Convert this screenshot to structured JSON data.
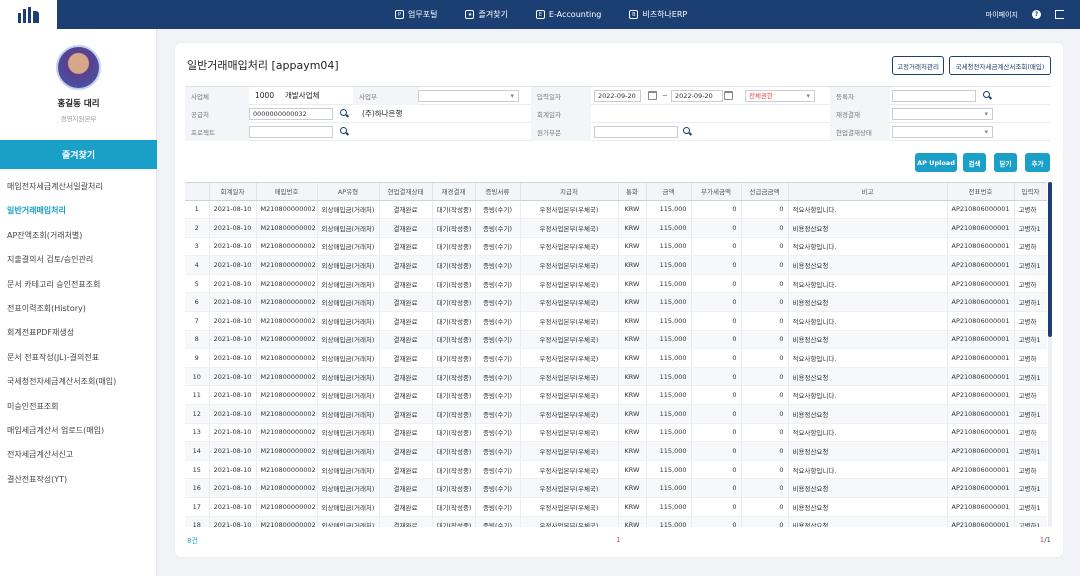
{
  "topbar": {
    "nav": [
      {
        "icon_char": "P",
        "label": "업무포털"
      },
      {
        "icon_char": "★",
        "label": "즐겨찾기"
      },
      {
        "icon_char": "E",
        "label": "E-Accounting"
      },
      {
        "icon_char": "B",
        "label": "비즈하나ERP"
      }
    ],
    "mypage": "마이페이지",
    "help_char": "?"
  },
  "user": {
    "name": "홍길동 대리",
    "dept": "경영지원본부"
  },
  "sidebar": {
    "header": "즐겨찾기",
    "items": [
      "매입전자세금계산서일괄처리",
      "일반거래매입처리",
      "AP잔액조회(거래처별)",
      "지출결의서 검토/승인관리",
      "문서 카테고리 승인전표조회",
      "전표이력조회(History)",
      "회계전표PDF재생성",
      "문서 전표작성(JL)-결의전표",
      "국세청전자세금계산서조회(매입)",
      "미승인전표조회",
      "매입세금계산서 업로드(매입)",
      "전자세금계산서신고",
      "결산전표작성(YT)"
    ]
  },
  "page": {
    "title": "일반거래매입처리  [appaym04]",
    "btn_supplier": "고정거래처관리",
    "btn_nts": "국세청전자세금계산서조회(매입)"
  },
  "form": {
    "biz_label": "사업체",
    "biz_code": "1000",
    "biz_name": "개발사업체",
    "dept_label": "사업부",
    "dept_value": "",
    "indate_label": "입력일자",
    "date_from": "2022-09-20",
    "date_to": "2022-09-20",
    "auth_value": "전체권한",
    "reg_label": "등록자",
    "reg_value": "",
    "supplier_label": "공급처",
    "supplier_code": "0000000000032",
    "supplier_name": "(주)하나은행",
    "accdate_label": "회계일자",
    "approval_label": "재경결재",
    "approval_value": "",
    "project_label": "프로젝트",
    "project_value": "",
    "cost_label": "원가부문",
    "cost_value": "",
    "site_label": "현업결재상태",
    "site_value": ""
  },
  "actions": {
    "upload": "AP Upload",
    "search": "검색",
    "close": "닫기",
    "add": "추가"
  },
  "grid": {
    "columns": [
      "",
      "회계일자",
      "매입번호",
      "AP유형",
      "현업결재상태",
      "재경결재",
      "증빙서류",
      "지급처",
      "통화",
      "금액",
      "부가세금액",
      "선급금금액",
      "비고",
      "전표번호",
      "입력자"
    ],
    "rows": [
      [
        "1",
        "2021-08-10",
        "M210800000002",
        "외상매입금(거래처)",
        "결재완료",
        "대기(작성중)",
        "증빙(수기)",
        "우정사업본부(우체국)",
        "KRW",
        "115,000",
        "0",
        "0",
        "적요사항입니다.",
        "AP210806000001",
        "고병하"
      ],
      [
        "2",
        "2021-08-10",
        "M210800000002",
        "외상매입금(거래처)",
        "결재완료",
        "대기(작성중)",
        "증빙(수기)",
        "우정사업본부(우체국)",
        "KRW",
        "115,000",
        "0",
        "0",
        "비용정산요청",
        "AP210806000001",
        "고병하1"
      ],
      [
        "3",
        "2021-08-10",
        "M210800000002",
        "외상매입금(거래처)",
        "결재완료",
        "대기(작성중)",
        "증빙(수기)",
        "우정사업본부(우체국)",
        "KRW",
        "115,000",
        "0",
        "0",
        "적요사항입니다.",
        "AP210806000001",
        "고병하"
      ],
      [
        "4",
        "2021-08-10",
        "M210800000002",
        "외상매입금(거래처)",
        "결재완료",
        "대기(작성중)",
        "증빙(수기)",
        "우정사업본부(우체국)",
        "KRW",
        "115,000",
        "0",
        "0",
        "비용정산요청",
        "AP210806000001",
        "고병하1"
      ],
      [
        "5",
        "2021-08-10",
        "M210800000002",
        "외상매입금(거래처)",
        "결재완료",
        "대기(작성중)",
        "증빙(수기)",
        "우정사업본부(우체국)",
        "KRW",
        "115,000",
        "0",
        "0",
        "적요사항입니다.",
        "AP210806000001",
        "고병하"
      ],
      [
        "6",
        "2021-08-10",
        "M210800000002",
        "외상매입금(거래처)",
        "결재완료",
        "대기(작성중)",
        "증빙(수기)",
        "우정사업본부(우체국)",
        "KRW",
        "115,000",
        "0",
        "0",
        "비용정산요청",
        "AP210806000001",
        "고병하1"
      ],
      [
        "7",
        "2021-08-10",
        "M210800000002",
        "외상매입금(거래처)",
        "결재완료",
        "대기(작성중)",
        "증빙(수기)",
        "우정사업본부(우체국)",
        "KRW",
        "115,000",
        "0",
        "0",
        "적요사항입니다.",
        "AP210806000001",
        "고병하"
      ],
      [
        "8",
        "2021-08-10",
        "M210800000002",
        "외상매입금(거래처)",
        "결재완료",
        "대기(작성중)",
        "증빙(수기)",
        "우정사업본부(우체국)",
        "KRW",
        "115,000",
        "0",
        "0",
        "비용정산요청",
        "AP210806000001",
        "고병하1"
      ],
      [
        "9",
        "2021-08-10",
        "M210800000002",
        "외상매입금(거래처)",
        "결재완료",
        "대기(작성중)",
        "증빙(수기)",
        "우정사업본부(우체국)",
        "KRW",
        "115,000",
        "0",
        "0",
        "적요사항입니다.",
        "AP210806000001",
        "고병하"
      ],
      [
        "10",
        "2021-08-10",
        "M210800000002",
        "외상매입금(거래처)",
        "결재완료",
        "대기(작성중)",
        "증빙(수기)",
        "우정사업본부(우체국)",
        "KRW",
        "115,000",
        "0",
        "0",
        "비용정산요청",
        "AP210806000001",
        "고병하1"
      ],
      [
        "11",
        "2021-08-10",
        "M210800000002",
        "외상매입금(거래처)",
        "결재완료",
        "대기(작성중)",
        "증빙(수기)",
        "우정사업본부(우체국)",
        "KRW",
        "115,000",
        "0",
        "0",
        "적요사항입니다.",
        "AP210806000001",
        "고병하"
      ],
      [
        "12",
        "2021-08-10",
        "M210800000002",
        "외상매입금(거래처)",
        "결재완료",
        "대기(작성중)",
        "증빙(수기)",
        "우정사업본부(우체국)",
        "KRW",
        "115,000",
        "0",
        "0",
        "비용정산요청",
        "AP210806000001",
        "고병하1"
      ],
      [
        "13",
        "2021-08-10",
        "M210800000002",
        "외상매입금(거래처)",
        "결재완료",
        "대기(작성중)",
        "증빙(수기)",
        "우정사업본부(우체국)",
        "KRW",
        "115,000",
        "0",
        "0",
        "적요사항입니다.",
        "AP210806000001",
        "고병하"
      ],
      [
        "14",
        "2021-08-10",
        "M210800000002",
        "외상매입금(거래처)",
        "결재완료",
        "대기(작성중)",
        "증빙(수기)",
        "우정사업본부(우체국)",
        "KRW",
        "115,000",
        "0",
        "0",
        "비용정산요청",
        "AP210806000001",
        "고병하1"
      ],
      [
        "15",
        "2021-08-10",
        "M210800000002",
        "외상매입금(거래처)",
        "결재완료",
        "대기(작성중)",
        "증빙(수기)",
        "우정사업본부(우체국)",
        "KRW",
        "115,000",
        "0",
        "0",
        "적요사항입니다.",
        "AP210806000001",
        "고병하"
      ],
      [
        "16",
        "2021-08-10",
        "M210800000002",
        "외상매입금(거래처)",
        "결재완료",
        "대기(작성중)",
        "증빙(수기)",
        "우정사업본부(우체국)",
        "KRW",
        "115,000",
        "0",
        "0",
        "비용정산요청",
        "AP210806000001",
        "고병하1"
      ],
      [
        "17",
        "2021-08-10",
        "M210800000002",
        "외상매입금(거래처)",
        "결재완료",
        "대기(작성중)",
        "증빙(수기)",
        "우정사업본부(우체국)",
        "KRW",
        "115,000",
        "0",
        "0",
        "비용정산요청",
        "AP210806000001",
        "고병하1"
      ],
      [
        "18",
        "2021-08-10",
        "M210800000002",
        "외상매입금(거래처)",
        "결재완료",
        "대기(작성중)",
        "증빙(수기)",
        "우정사업본부(우체국)",
        "KRW",
        "115,000",
        "0",
        "0",
        "비용정산요청",
        "AP210806000001",
        "고병하1"
      ]
    ]
  },
  "footer": {
    "count": "8건",
    "page": "1",
    "page_current": "1",
    "page_total": "/1"
  }
}
